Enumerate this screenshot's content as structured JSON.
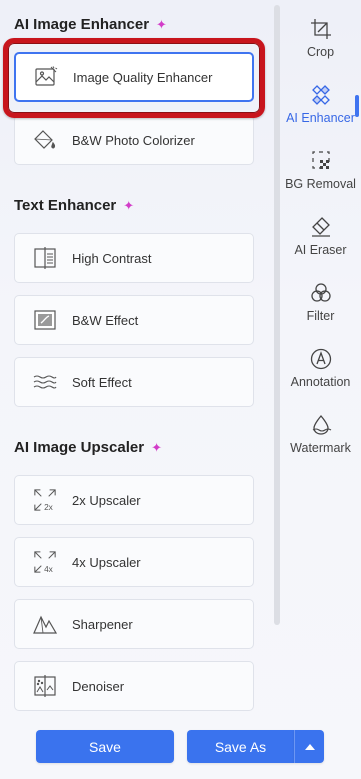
{
  "sections": {
    "ai_image_enhancer": {
      "title": "AI Image Enhancer",
      "items": [
        {
          "label": "Image Quality Enhancer",
          "icon": "image-enhance-icon"
        },
        {
          "label": "B&W Photo Colorizer",
          "icon": "paint-bucket-icon"
        }
      ]
    },
    "text_enhancer": {
      "title": "Text Enhancer",
      "items": [
        {
          "label": "High Contrast",
          "icon": "high-contrast-icon"
        },
        {
          "label": "B&W Effect",
          "icon": "bw-effect-icon"
        },
        {
          "label": "Soft Effect",
          "icon": "soft-effect-icon"
        }
      ]
    },
    "ai_image_upscaler": {
      "title": "AI Image Upscaler",
      "items": [
        {
          "label": "2x Upscaler",
          "icon": "upscale-2x-icon",
          "badge": "2x"
        },
        {
          "label": "4x Upscaler",
          "icon": "upscale-4x-icon",
          "badge": "4x"
        },
        {
          "label": "Sharpener",
          "icon": "sharpener-icon"
        },
        {
          "label": "Denoiser",
          "icon": "denoiser-icon"
        }
      ]
    }
  },
  "sparkle": "✦",
  "rail": [
    {
      "label": "Crop",
      "icon": "crop-icon"
    },
    {
      "label": "AI Enhancer",
      "icon": "ai-enhancer-icon",
      "active": true
    },
    {
      "label": "BG Removal",
      "icon": "bg-removal-icon"
    },
    {
      "label": "AI Eraser",
      "icon": "eraser-icon"
    },
    {
      "label": "Filter",
      "icon": "filter-icon"
    },
    {
      "label": "Annotation",
      "icon": "annotation-icon"
    },
    {
      "label": "Watermark",
      "icon": "watermark-icon"
    }
  ],
  "footer": {
    "save_label": "Save",
    "save_as_label": "Save As"
  },
  "colors": {
    "accent": "#3a73ee",
    "highlight_ring": "#c8151d",
    "sparkle": "#d23cc8"
  }
}
